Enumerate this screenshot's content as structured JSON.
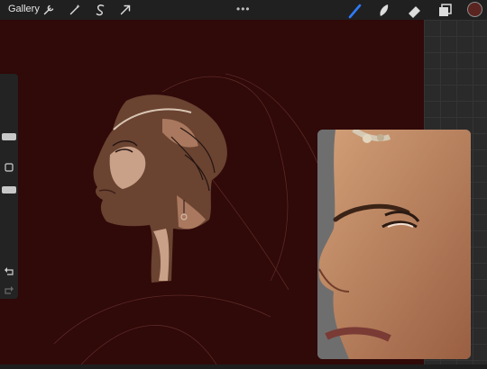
{
  "topbar": {
    "gallery_label": "Gallery",
    "left_tools": [
      "wrench-icon",
      "magic-wand-icon",
      "selection-s-icon",
      "move-arrow-icon"
    ],
    "right_tools": [
      "brush-icon",
      "smudge-icon",
      "eraser-icon",
      "layers-icon"
    ],
    "active_tool": "brush-icon",
    "brush_color": "#5a2420",
    "more_dots": "•••"
  },
  "colors": {
    "canvas": "#300909",
    "active_tool": "#2f7bff",
    "skin_dark": "#6a4331",
    "skin_light": "#c9a088"
  },
  "sidebar": {
    "items": [
      "brush-size-slider",
      "modify-button",
      "opacity-slider",
      "undo-button",
      "redo-button"
    ]
  }
}
